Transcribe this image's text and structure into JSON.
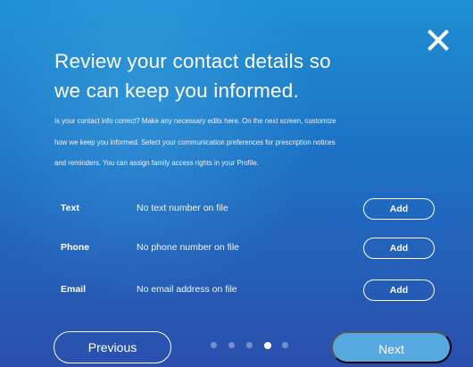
{
  "modal": {
    "close_icon": "close-icon",
    "title_line1": "Review your contact details so",
    "title_line2": "we can keep you informed.",
    "description_line1": "Is your contact info correct? Make any necessary edits here. On the next screen, customize",
    "description_line2": "how we keep you informed. Select your communication preferences for prescription notices",
    "description_line3": "and reminders. You can assign family access rights in your Profile."
  },
  "contacts": [
    {
      "label": "Text",
      "value": "No text number on file",
      "action": "Add"
    },
    {
      "label": "Phone",
      "value": "No phone number on file",
      "action": "Add"
    },
    {
      "label": "Email",
      "value": "No email address on file",
      "action": "Add"
    }
  ],
  "navigation": {
    "previous_label": "Previous",
    "next_label": "Next",
    "total_steps": 5,
    "current_step": 4
  },
  "colors": {
    "gradient_top": "#1f8fd3",
    "gradient_bottom": "#2b4fad",
    "next_button": "#55a9e0",
    "text": "#ffffff"
  }
}
